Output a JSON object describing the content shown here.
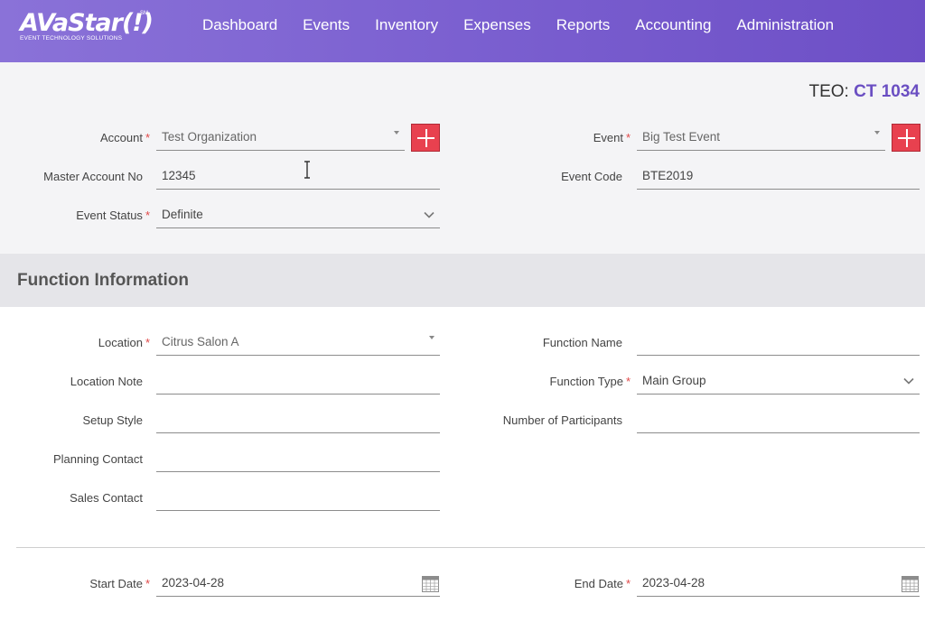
{
  "header": {
    "logo_text": "AVaStar(!)",
    "logo_mark": "SM",
    "logo_tagline": "EVENT TECHNOLOGY SOLUTIONS",
    "nav": [
      "Dashboard",
      "Events",
      "Inventory",
      "Expenses",
      "Reports",
      "Accounting",
      "Administration"
    ]
  },
  "teo": {
    "label": "TEO:",
    "value": "CT 1034"
  },
  "event_section": {
    "account": {
      "label": "Account",
      "value": "Test Organization"
    },
    "master_account_no": {
      "label": "Master Account No",
      "value": "12345"
    },
    "event_status": {
      "label": "Event Status",
      "value": "Definite"
    },
    "event": {
      "label": "Event",
      "value": "Big Test Event"
    },
    "event_code": {
      "label": "Event Code",
      "value": "BTE2019"
    }
  },
  "function_section": {
    "title": "Function Information",
    "location": {
      "label": "Location",
      "value": "Citrus Salon A"
    },
    "location_note": {
      "label": "Location Note",
      "value": ""
    },
    "setup_style": {
      "label": "Setup Style",
      "value": ""
    },
    "planning_contact": {
      "label": "Planning Contact",
      "value": ""
    },
    "sales_contact": {
      "label": "Sales Contact",
      "value": ""
    },
    "function_name": {
      "label": "Function Name",
      "value": ""
    },
    "function_type": {
      "label": "Function Type",
      "value": "Main Group"
    },
    "number_of_participants": {
      "label": "Number of Participants",
      "value": ""
    },
    "start_date": {
      "label": "Start Date",
      "value": "2023-04-28"
    },
    "end_date": {
      "label": "End Date",
      "value": "2023-04-28"
    }
  },
  "required_marker": "*",
  "colors": {
    "header_start": "#8a72d8",
    "header_end": "#6d4fc6",
    "accent": "#6a4ec2",
    "add_button": "#e8414f",
    "required": "#e04848"
  }
}
